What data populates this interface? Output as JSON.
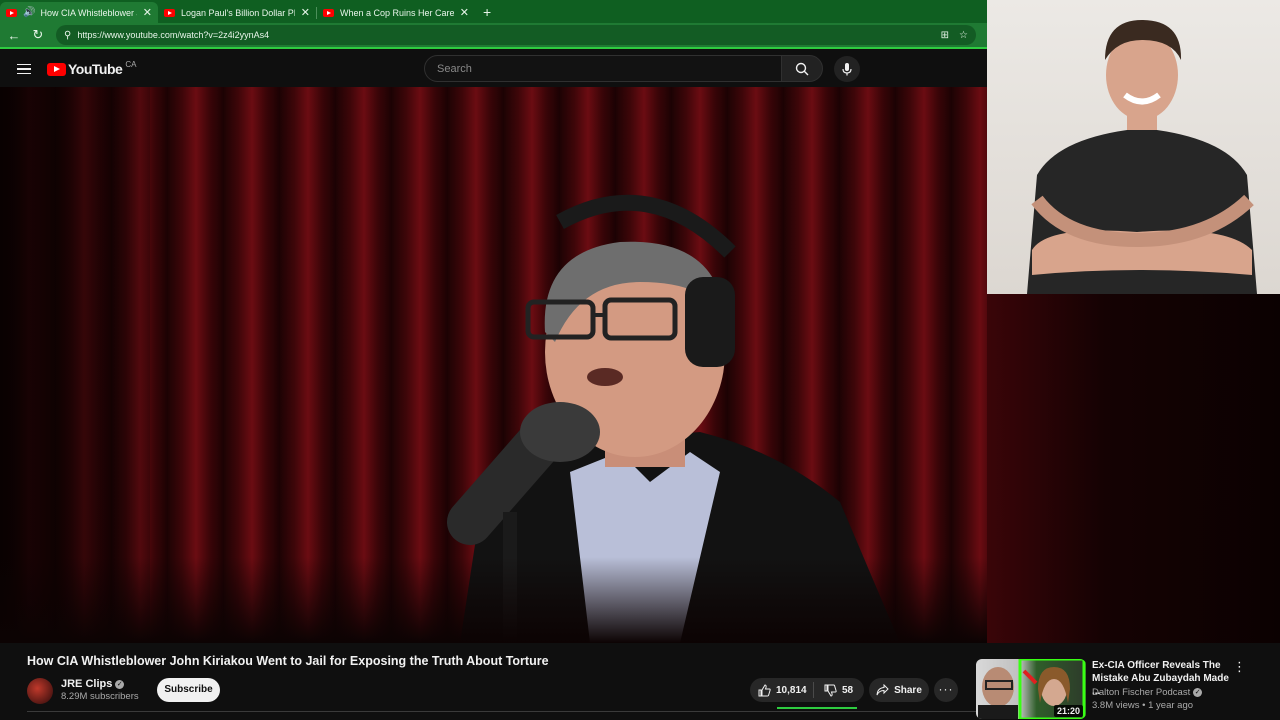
{
  "browser": {
    "tabs": [
      {
        "title": "How CIA Whistleblower John",
        "active": true,
        "audio": true
      },
      {
        "title": "Logan Paul's Billion Dollar PRIME",
        "active": false,
        "audio": false
      },
      {
        "title": "When a Cop Ruins Her Career In",
        "active": false,
        "audio": false
      }
    ],
    "url": "https://www.youtube.com/watch?v=2z4i2yynAs4",
    "theme_color": "#1f7a33"
  },
  "youtube": {
    "logo_text": "YouTube",
    "country": "CA",
    "search_placeholder": "Search"
  },
  "video": {
    "title": "How CIA Whistleblower John Kiriakou Went to Jail for Exposing the Truth About Torture",
    "channel": "JRE Clips",
    "subscribers": "8.29M subscribers",
    "subscribe_label": "Subscribe",
    "likes": "10,814",
    "dislikes": "58",
    "share_label": "Share"
  },
  "recommendation": {
    "title": "Ex-CIA Officer Reveals The Mistake Abu Zubaydah Made ...",
    "channel": "Dalton Fischer Podcast",
    "meta": "3.8M views • 1 year ago",
    "duration": "21:20"
  }
}
